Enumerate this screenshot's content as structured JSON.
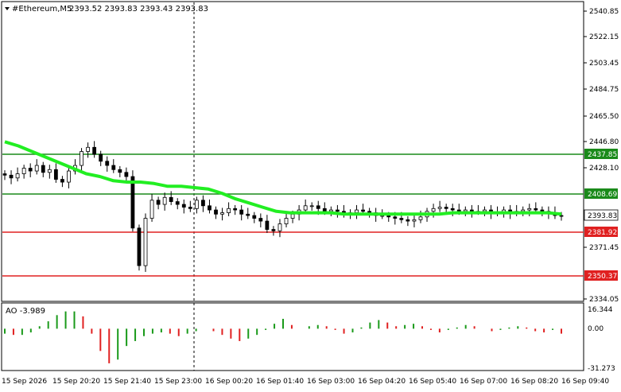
{
  "header": {
    "symbol_label": "#Ethereum,M5",
    "ohlc_text": "2393.52 2393.83 2393.43 2393.83"
  },
  "price_axis": {
    "ticks": [
      "2540.85",
      "2522.15",
      "2503.45",
      "2484.75",
      "2465.50",
      "2446.80",
      "2428.10",
      "2371.45",
      "2334.05"
    ],
    "ylim": [
      2334.05,
      2540.85
    ]
  },
  "levels": [
    {
      "name": "resistance-upper",
      "label": "2437.85",
      "value": 2437.85,
      "color": "#1a8a1a",
      "style": "solid"
    },
    {
      "name": "resistance-lower",
      "label": "2408.69",
      "value": 2408.69,
      "color": "#1a8a1a",
      "style": "solid"
    },
    {
      "name": "support-upper",
      "label": "2381.92",
      "value": 2381.92,
      "color": "#e02020",
      "style": "solid"
    },
    {
      "name": "support-lower",
      "label": "2350.37",
      "value": 2350.37,
      "color": "#e02020",
      "style": "solid"
    }
  ],
  "current_price": {
    "label": "2393.83",
    "value": 2393.83
  },
  "ao_panel": {
    "title": "AO -3.989",
    "ticks": [
      "16.344",
      "0.00",
      "-31.273"
    ],
    "range": [
      -31.273,
      16.344
    ],
    "up_color": "#1a9a1a",
    "down_color": "#e02020"
  },
  "time_axis": {
    "labels": [
      "15 Sep 2026",
      "15 Sep 20:20",
      "15 Sep 21:40",
      "15 Sep 23:00",
      "16 Sep 00:20",
      "16 Sep 01:40",
      "16 Sep 03:00",
      "16 Sep 04:20",
      "16 Sep 05:40",
      "16 Sep 07:00",
      "16 Sep 08:20",
      "16 Sep 09:40"
    ]
  },
  "chart_data": {
    "type": "candlestick",
    "symbol": "#Ethereum",
    "timeframe": "M5",
    "approx_closes": [
      2423,
      2421,
      2424,
      2428,
      2426,
      2430,
      2425,
      2427,
      2420,
      2418,
      2426,
      2430,
      2440,
      2443,
      2438,
      2433,
      2430,
      2427,
      2425,
      2422,
      2385,
      2358,
      2392,
      2405,
      2402,
      2407,
      2404,
      2402,
      2400,
      2399,
      2405,
      2401,
      2398,
      2395,
      2396,
      2399,
      2398,
      2395,
      2394,
      2392,
      2390,
      2384,
      2383,
      2388,
      2392,
      2395,
      2398,
      2401,
      2401,
      2399,
      2397,
      2398,
      2397,
      2395,
      2396,
      2398,
      2397,
      2396,
      2394,
      2394,
      2393,
      2392,
      2391,
      2390,
      2391,
      2393,
      2397,
      2399,
      2400,
      2399,
      2398,
      2397,
      2398,
      2397,
      2397,
      2398,
      2396,
      2396,
      2398,
      2396,
      2397,
      2398,
      2399,
      2398,
      2397,
      2396,
      2394,
      2393.83
    ],
    "moving_average": [
      2447,
      2444,
      2440,
      2436,
      2432,
      2428,
      2424,
      2422,
      2419,
      2418,
      2418,
      2417,
      2415,
      2415,
      2414,
      2413,
      2410,
      2406,
      2403,
      2400,
      2397,
      2396,
      2396,
      2396,
      2396,
      2395,
      2395,
      2395,
      2395,
      2395,
      2395,
      2395,
      2395,
      2396,
      2396,
      2396,
      2396,
      2396,
      2396,
      2396,
      2396,
      2395
    ],
    "ao_values": [
      -4,
      -5,
      -5,
      -3,
      2,
      6,
      11,
      14,
      14,
      10,
      -4,
      -18,
      -28,
      -25,
      -14,
      -10,
      -6,
      -4,
      -3,
      -4,
      -6,
      -4,
      -2,
      0,
      -2,
      -5,
      -8,
      -10,
      -8,
      -5,
      -1,
      4,
      8,
      3,
      0,
      2,
      3,
      2,
      -1,
      -4,
      -3,
      1,
      5,
      7,
      5,
      2,
      3,
      4,
      2,
      -1,
      -3,
      -1,
      1,
      3,
      2,
      0,
      -2,
      -1,
      1,
      2,
      1,
      -2,
      -3,
      -1,
      -3.989
    ]
  }
}
